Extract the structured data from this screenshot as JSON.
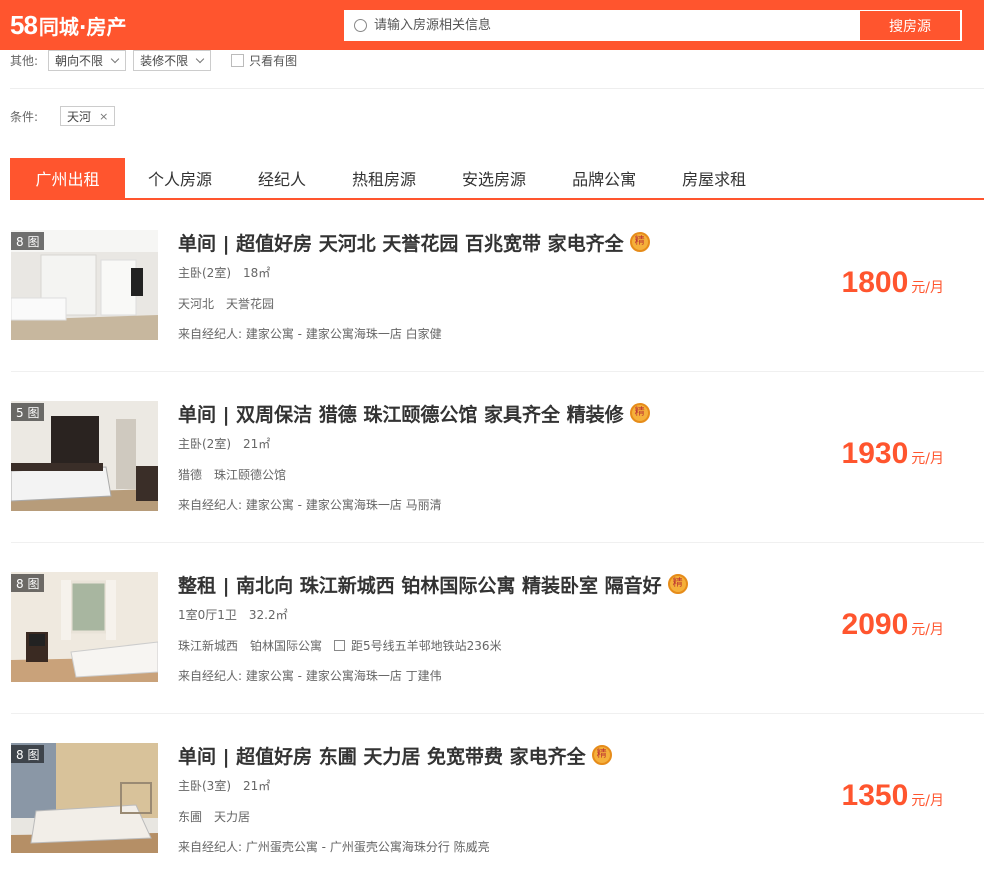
{
  "header": {
    "logo_number": "58",
    "logo_text": "同城·房产",
    "search_placeholder": "请输入房源相关信息",
    "search_button": "搜房源",
    "colors": {
      "brand": "#ff552e"
    }
  },
  "filters": {
    "other_label": "其他:",
    "orientation_select": "朝向不限",
    "decoration_select": "装修不限",
    "only_with_photo": "只看有图",
    "condition_label": "条件:",
    "condition_tag": "天河",
    "remove_icon": "×"
  },
  "tabs": [
    "广州出租",
    "个人房源",
    "经纪人",
    "热租房源",
    "安选房源",
    "品牌公寓",
    "房屋求租"
  ],
  "listings": [
    {
      "photo_count": "8 图",
      "title": "单间 | 超值好房 天河北 天誉花园 百兆宽带 家电齐全",
      "badge": "精",
      "room": "主卧(2室)",
      "area": "18㎡",
      "district": "天河北",
      "community": "天誉花园",
      "metro": "",
      "source": "来自经纪人: 建家公寓 - 建家公寓海珠一店 白家健",
      "price": "1800",
      "unit": "元/月"
    },
    {
      "photo_count": "5 图",
      "title": "单间 | 双周保洁 猎德 珠江颐德公馆 家具齐全 精装修",
      "badge": "精",
      "room": "主卧(2室)",
      "area": "21㎡",
      "district": "猎德",
      "community": "珠江颐德公馆",
      "metro": "",
      "source": "来自经纪人: 建家公寓 - 建家公寓海珠一店 马丽清",
      "price": "1930",
      "unit": "元/月"
    },
    {
      "photo_count": "8 图",
      "title": "整租 | 南北向 珠江新城西 铂林国际公寓 精装卧室 隔音好",
      "badge": "精",
      "room": "1室0厅1卫",
      "area": "32.2㎡",
      "district": "珠江新城西",
      "community": "铂林国际公寓",
      "metro": "距5号线五羊邨地铁站236米",
      "source": "来自经纪人: 建家公寓 - 建家公寓海珠一店 丁建伟",
      "price": "2090",
      "unit": "元/月"
    },
    {
      "photo_count": "8 图",
      "title": "单间 | 超值好房 东圃 天力居 免宽带费 家电齐全",
      "badge": "精",
      "room": "主卧(3室)",
      "area": "21㎡",
      "district": "东圃",
      "community": "天力居",
      "metro": "",
      "source": "来自经纪人: 广州蛋壳公寓 - 广州蛋壳公寓海珠分行 陈威亮",
      "price": "1350",
      "unit": "元/月"
    }
  ]
}
